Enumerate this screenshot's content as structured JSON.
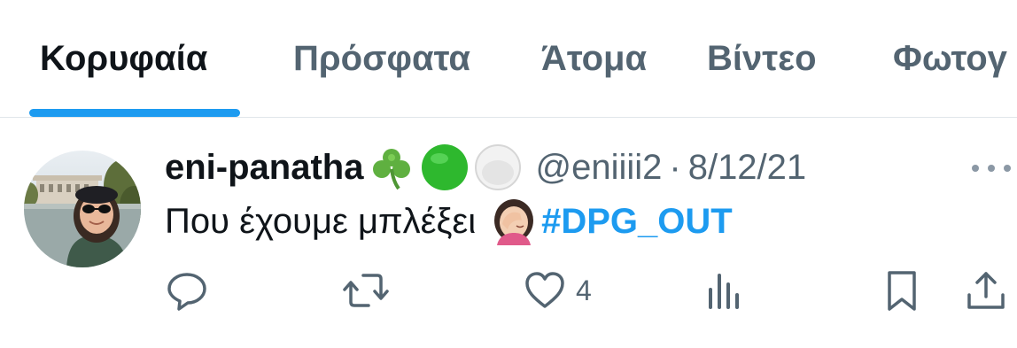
{
  "tabs": [
    {
      "label": "Κορυφαία",
      "active": true
    },
    {
      "label": "Πρόσφατα",
      "active": false
    },
    {
      "label": "Άτομα",
      "active": false
    },
    {
      "label": "Βίντεο",
      "active": false
    },
    {
      "label": "Φωτογ",
      "active": false
    }
  ],
  "colors": {
    "accent": "#1d9bf0",
    "primary_text": "#0f1419",
    "secondary_text": "#536471"
  },
  "tweet": {
    "display_name": "eni-panatha",
    "name_emojis": [
      "shamrock-icon",
      "green-circle-icon",
      "white-circle-icon"
    ],
    "handle": "@eniiii2",
    "separator": "·",
    "date": "8/12/21",
    "text": "Που έχουμε μπλέξει",
    "text_emoji": "facepalm-icon",
    "hashtag": "#DPG_OUT",
    "actions": {
      "reply_icon": "reply-icon",
      "retweet_icon": "retweet-icon",
      "like_icon": "heart-icon",
      "like_count": "4",
      "views_icon": "views-icon",
      "bookmark_icon": "bookmark-icon",
      "share_icon": "share-icon"
    }
  }
}
